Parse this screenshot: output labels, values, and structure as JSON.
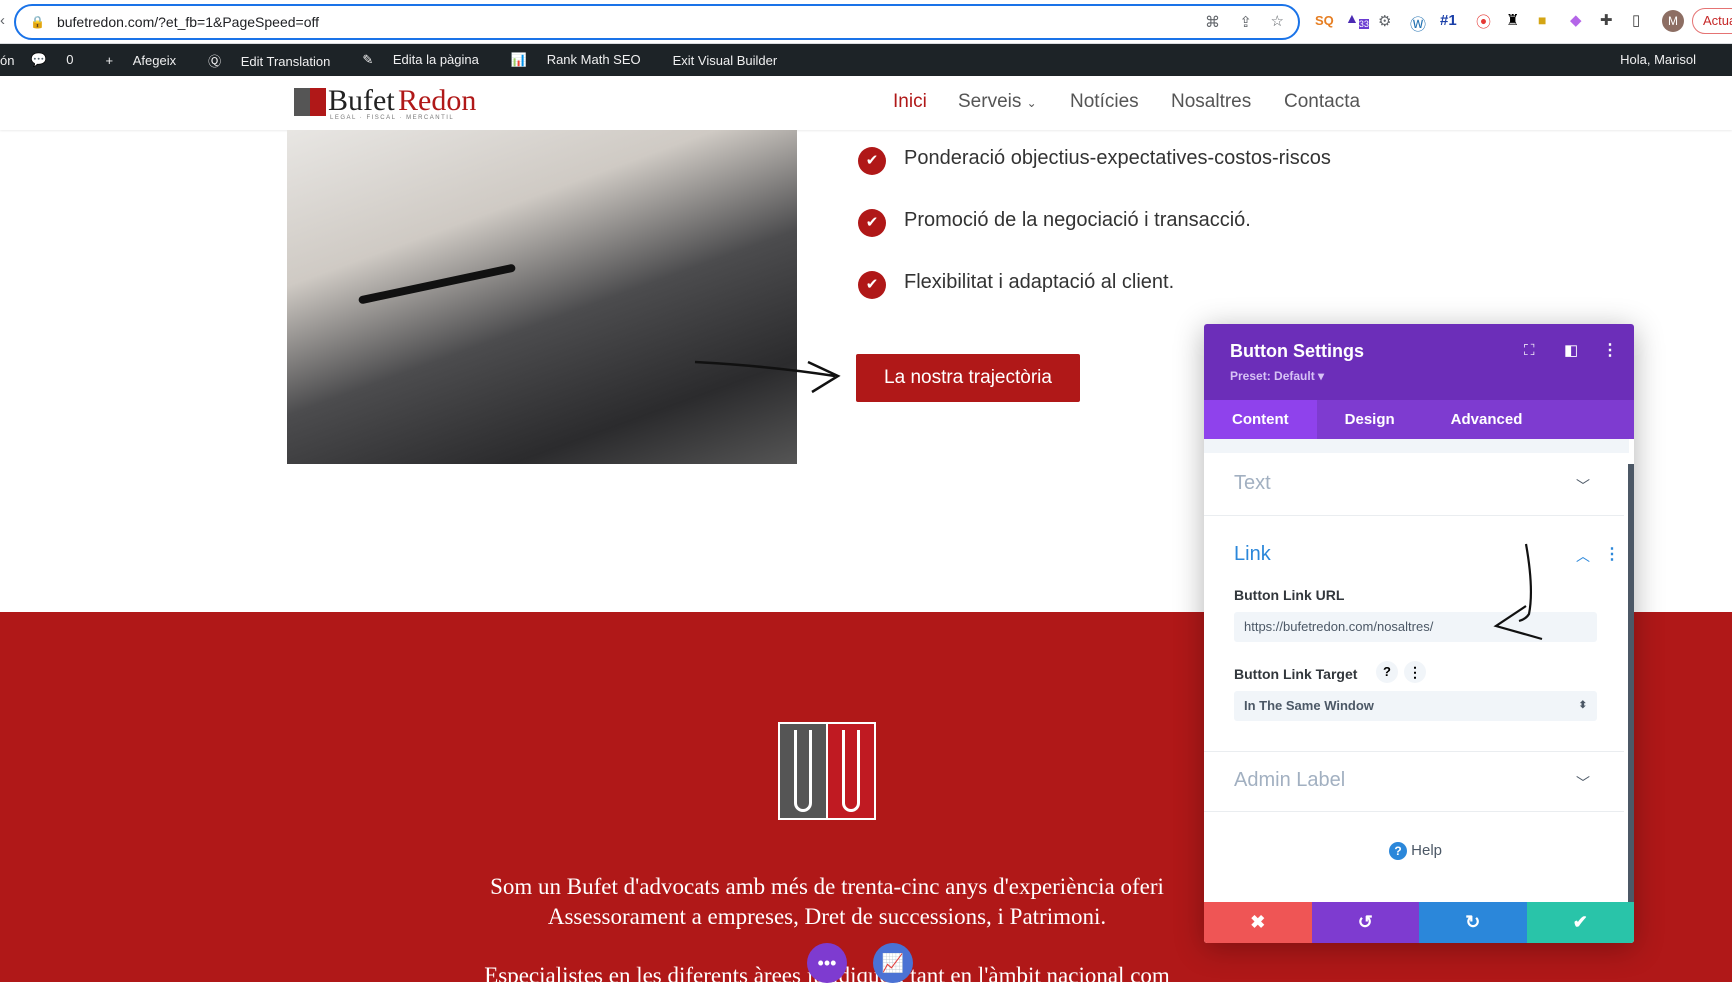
{
  "browser": {
    "url": "bufetredon.com/?et_fb=1&PageSpeed=off",
    "extension_badge": "33",
    "rank_badge": "#1",
    "profile_initial": "M",
    "update_label": "Actua"
  },
  "adminbar": {
    "items": [
      "ón",
      "0",
      "Afegeix",
      "Edit Translation",
      "Edita la pàgina",
      "Rank Math SEO",
      "Exit Visual Builder"
    ],
    "greeting": "Hola, Marisol"
  },
  "site": {
    "logo_text_1": "Bufet",
    "logo_text_2": "Redon",
    "logo_tagline": "LEGAL · FISCAL · MERCANTIL",
    "nav": [
      "Inici",
      "Serveis",
      "Notícies",
      "Nosaltres",
      "Contacta"
    ],
    "checklist": [
      "Ponderació objectius-expectatives-costos-riscos",
      "Promoció de la negociació i transacció.",
      "Flexibilitat i adaptació al client."
    ],
    "cta_button": "La nostra trajectòria",
    "about": [
      "Som un Bufet d'advocats amb més de trenta-cinc anys d'experiència oferi",
      "Assessorament a empreses, Dret de successions, i Patrimoni.",
      "Especialistes en les diferents àrees jurídiques, tant en l'àmbit nacional com"
    ]
  },
  "panel": {
    "title": "Button Settings",
    "preset": "Preset: Default",
    "tabs": [
      "Content",
      "Design",
      "Advanced"
    ],
    "sections": {
      "text": "Text",
      "link": "Link",
      "admin": "Admin Label"
    },
    "url_label": "Button Link URL",
    "url_value": "https://bufetredon.com/nosaltres/",
    "target_label": "Button Link Target",
    "target_value": "In The Same Window",
    "help_q": "?",
    "help": "Help"
  },
  "colors": {
    "brand_red": "#b01818",
    "panel_purple": "#6c2eb9",
    "cancel": "#ef5555",
    "undo": "#7e3bd0",
    "redo": "#2b87da",
    "save": "#29c4a9"
  }
}
